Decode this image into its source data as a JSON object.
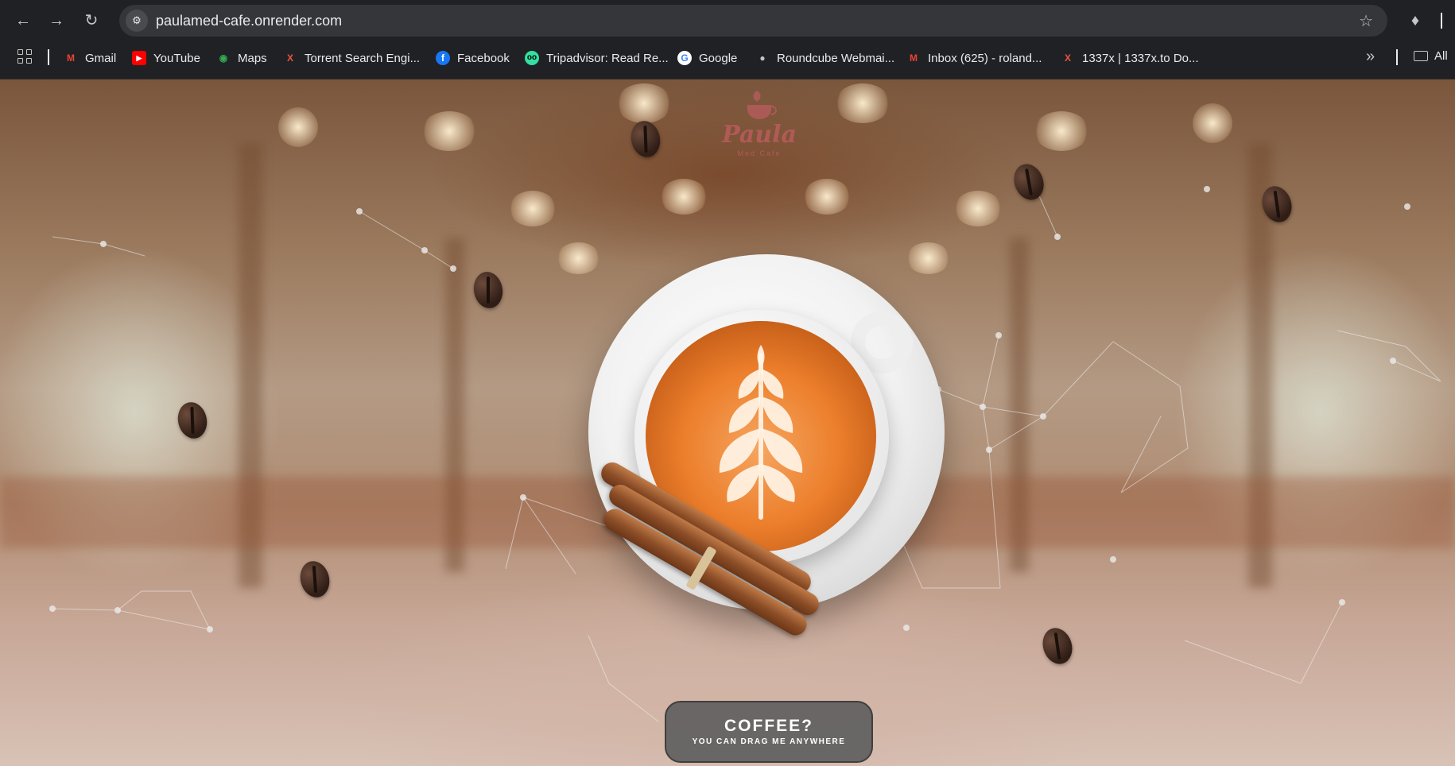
{
  "browser": {
    "url": "paulamed-cafe.onrender.com",
    "nav": {
      "back_icon": "arrow-left",
      "forward_icon": "arrow-right",
      "reload_icon": "reload"
    }
  },
  "bookmarks": {
    "items": [
      {
        "label": "Gmail",
        "icon": "gmail-icon",
        "color": "#EA4335"
      },
      {
        "label": "YouTube",
        "icon": "youtube-icon",
        "color": "#FF0000"
      },
      {
        "label": "Maps",
        "icon": "maps-icon",
        "color": "#34A853"
      },
      {
        "label": "Torrent Search Engi...",
        "icon": "x-icon",
        "color": "#E8553F"
      },
      {
        "label": "Facebook",
        "icon": "facebook-icon",
        "color": "#1877F2"
      },
      {
        "label": "Tripadvisor: Read Re...",
        "icon": "tripadvisor-icon",
        "color": "#34E0A1"
      },
      {
        "label": "Google",
        "icon": "google-icon",
        "color": "#4285F4"
      },
      {
        "label": "Roundcube Webmai...",
        "icon": "roundcube-icon",
        "color": "#BFC5CC"
      },
      {
        "label": "Inbox (625) - roland...",
        "icon": "gmail-icon",
        "color": "#EA4335"
      },
      {
        "label": "1337x | 1337x.to Do...",
        "icon": "x-icon",
        "color": "#E8553F"
      }
    ],
    "all_label": "All"
  },
  "page": {
    "logo": {
      "name": "Paula",
      "sub": "Med Cafe"
    },
    "drag_card": {
      "title": "COFFEE?",
      "subtitle": "YOU CAN DRAG ME ANYWHERE"
    }
  }
}
